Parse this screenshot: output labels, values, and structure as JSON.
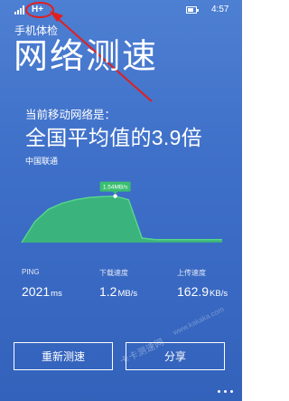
{
  "status_bar": {
    "network_type": "H+",
    "time": "4:57",
    "icons": [
      "signal-icon",
      "battery-icon"
    ],
    "highlight_color": "#e02020"
  },
  "app": {
    "title": "手机体检",
    "page_title": "网络测速"
  },
  "result": {
    "label": "当前移动网络是：",
    "comparison": "全国平均值的3.9倍",
    "carrier": "中国联通"
  },
  "chart_data": {
    "type": "area",
    "x": [
      0,
      1,
      2,
      3,
      4,
      5,
      6,
      7,
      8,
      9,
      10,
      11,
      12,
      13,
      14,
      15
    ],
    "y": [
      0.0,
      0.7,
      1.1,
      1.3,
      1.42,
      1.49,
      1.52,
      1.54,
      1.42,
      0.15,
      0.1,
      0.1,
      0.1,
      0.1,
      0.1,
      0.1
    ],
    "peak_label": "1.54MB/s",
    "peak_index": 7,
    "ylim": [
      0,
      1.8
    ],
    "fill_color": "#3bbf6f",
    "line_color": "#56d68a",
    "badge_color": "#3bbf6f"
  },
  "metrics": [
    {
      "label": "PING",
      "value": "2021",
      "unit": "ms"
    },
    {
      "label": "下载速度",
      "value": "1.2",
      "unit": "MB/s"
    },
    {
      "label": "上传速度",
      "value": "162.9",
      "unit": "KB/s"
    }
  ],
  "buttons": {
    "retest": "重新测速",
    "share": "分享"
  },
  "watermark": {
    "text": "卡卡测速网",
    "url": "www.kakaka.com"
  },
  "colors": {
    "background": "#3d6ec8",
    "text": "#ffffff"
  }
}
